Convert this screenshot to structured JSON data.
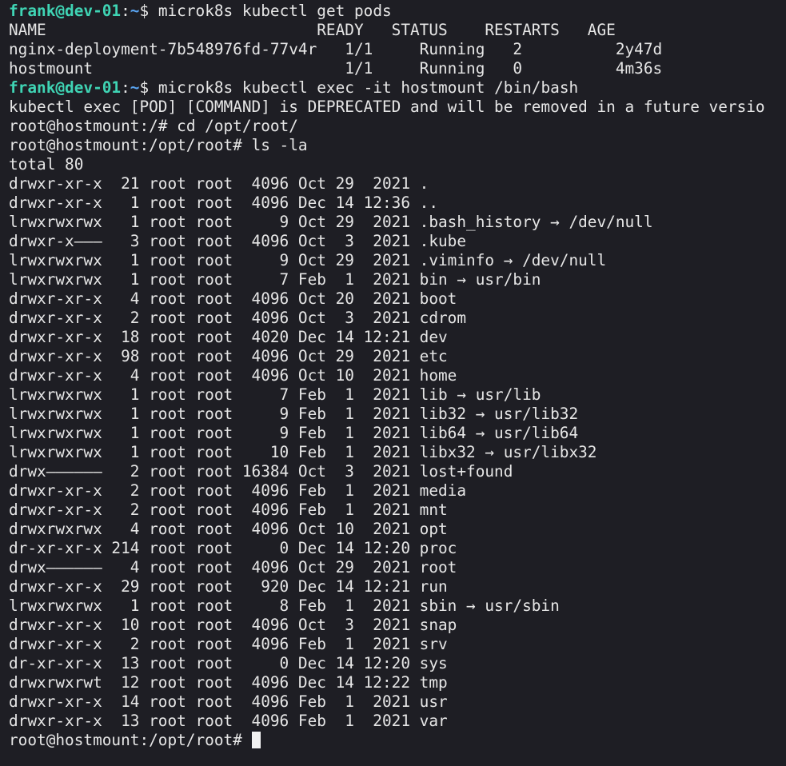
{
  "colors": {
    "background": "#1e1e24",
    "foreground": "#e6e6e6",
    "user_host": "#3fd4b4",
    "cwd": "#5aa5f2"
  },
  "session": {
    "user_host": "frank@dev-01",
    "sep": ":",
    "cwd": "~",
    "symbol": "$ ",
    "cmd1": "microk8s kubectl get pods",
    "cmd2": "microk8s kubectl exec -it hostmount /bin/bash"
  },
  "pods": {
    "header": "NAME                             READY   STATUS    RESTARTS   AGE",
    "rows": [
      "nginx-deployment-7b548976fd-77v4r   1/1     Running   2          2y47d",
      "hostmount                           1/1     Running   0          4m36s"
    ]
  },
  "exec_warning": "kubectl exec [POD] [COMMAND] is DEPRECATED and will be removed in a future versio",
  "container": {
    "prompt_cd": "root@hostmount:/# ",
    "cmd_cd": "cd /opt/root/",
    "prompt_ls": "root@hostmount:/opt/root# ",
    "cmd_ls": "ls -la",
    "prompt_final": "root@hostmount:/opt/root# "
  },
  "listing": {
    "total": "total 80",
    "entries": [
      "drwxr-xr-x  21 root root  4096 Oct 29  2021 .",
      "drwxr-xr-x   1 root root  4096 Dec 14 12:36 ..",
      "lrwxrwxrwx   1 root root     9 Oct 29  2021 .bash_history → /dev/null",
      "drwxr-x———   3 root root  4096 Oct  3  2021 .kube",
      "lrwxrwxrwx   1 root root     9 Oct 29  2021 .viminfo → /dev/null",
      "lrwxrwxrwx   1 root root     7 Feb  1  2021 bin → usr/bin",
      "drwxr-xr-x   4 root root  4096 Oct 20  2021 boot",
      "drwxr-xr-x   2 root root  4096 Oct  3  2021 cdrom",
      "drwxr-xr-x  18 root root  4020 Dec 14 12:21 dev",
      "drwxr-xr-x  98 root root  4096 Oct 29  2021 etc",
      "drwxr-xr-x   4 root root  4096 Oct 10  2021 home",
      "lrwxrwxrwx   1 root root     7 Feb  1  2021 lib → usr/lib",
      "lrwxrwxrwx   1 root root     9 Feb  1  2021 lib32 → usr/lib32",
      "lrwxrwxrwx   1 root root     9 Feb  1  2021 lib64 → usr/lib64",
      "lrwxrwxrwx   1 root root    10 Feb  1  2021 libx32 → usr/libx32",
      "drwx——————   2 root root 16384 Oct  3  2021 lost+found",
      "drwxr-xr-x   2 root root  4096 Feb  1  2021 media",
      "drwxr-xr-x   2 root root  4096 Feb  1  2021 mnt",
      "drwxrwxrwx   4 root root  4096 Oct 10  2021 opt",
      "dr-xr-xr-x 214 root root     0 Dec 14 12:20 proc",
      "drwx——————   4 root root  4096 Oct 29  2021 root",
      "drwxr-xr-x  29 root root   920 Dec 14 12:21 run",
      "lrwxrwxrwx   1 root root     8 Feb  1  2021 sbin → usr/sbin",
      "drwxr-xr-x  10 root root  4096 Oct  3  2021 snap",
      "drwxr-xr-x   2 root root  4096 Feb  1  2021 srv",
      "dr-xr-xr-x  13 root root     0 Dec 14 12:20 sys",
      "drwxrwxrwt  12 root root  4096 Dec 14 12:22 tmp",
      "drwxr-xr-x  14 root root  4096 Feb  1  2021 usr",
      "drwxr-xr-x  13 root root  4096 Feb  1  2021 var"
    ]
  }
}
